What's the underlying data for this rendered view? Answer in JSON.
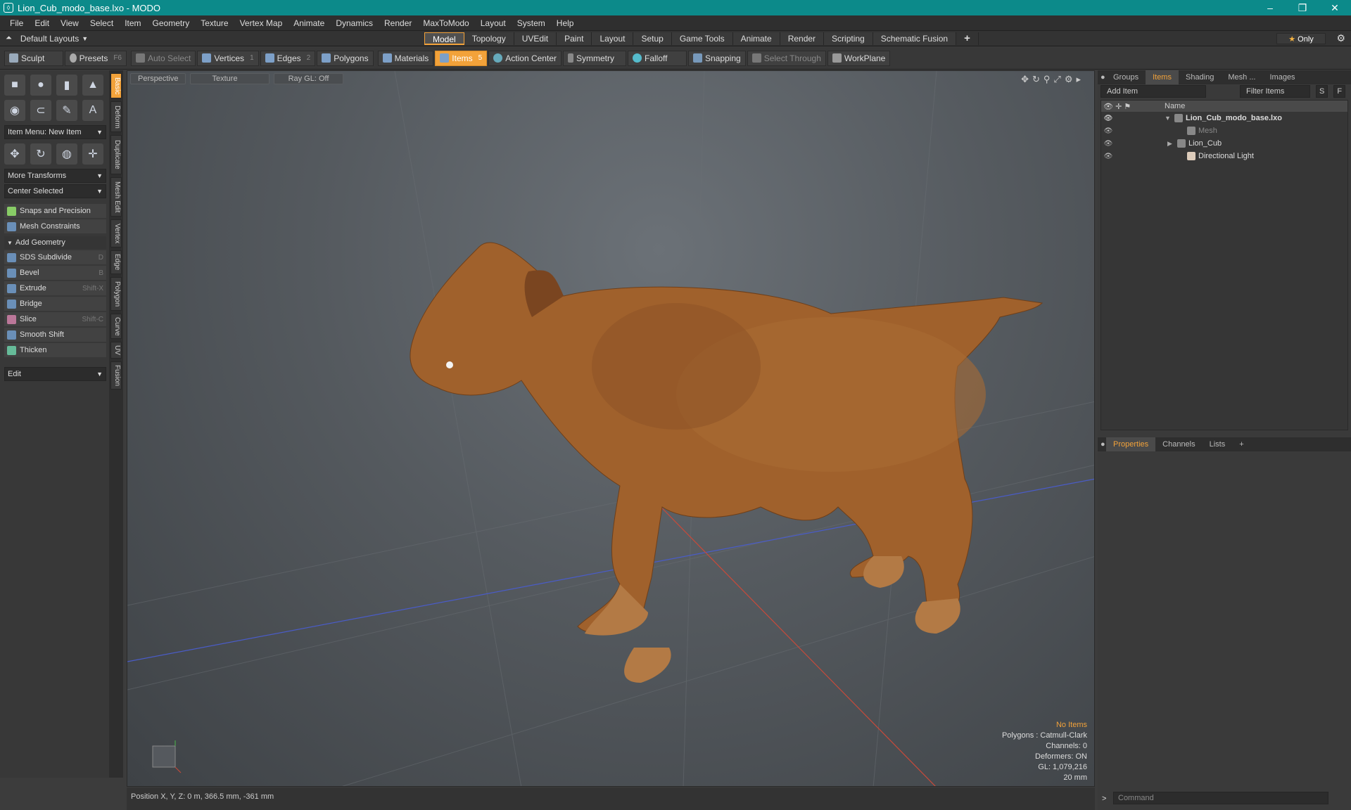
{
  "window": {
    "title": "Lion_Cub_modo_base.lxo - MODO",
    "min": "–",
    "max": "❐",
    "close": "✕"
  },
  "menu": [
    "File",
    "Edit",
    "View",
    "Select",
    "Item",
    "Geometry",
    "Texture",
    "Vertex Map",
    "Animate",
    "Dynamics",
    "Render",
    "MaxToModo",
    "Layout",
    "System",
    "Help"
  ],
  "layoutbar": {
    "layouts": "Default Layouts",
    "tabs": [
      "Model",
      "Topology",
      "UVEdit",
      "Paint",
      "Layout",
      "Setup",
      "Game Tools",
      "Animate",
      "Render",
      "Scripting",
      "Schematic Fusion"
    ],
    "active": "Model",
    "plus": "+",
    "only": "Only",
    "only_icon": "★"
  },
  "toolbar": {
    "sculpt": "Sculpt",
    "presets": "Presets",
    "presets_key": "F6",
    "auto_select": "Auto Select",
    "vertices": "Vertices",
    "vertices_n": "1",
    "edges": "Edges",
    "edges_n": "2",
    "polygons": "Polygons",
    "materials": "Materials",
    "items": "Items",
    "items_n": "5",
    "action_center": "Action Center",
    "symmetry": "Symmetry",
    "falloff": "Falloff",
    "snapping": "Snapping",
    "select_through": "Select Through",
    "workplane": "WorkPlane"
  },
  "left": {
    "item_menu": "Item Menu: New Item",
    "more_transforms": "More Transforms",
    "center_selected": "Center Selected",
    "snaps": "Snaps and Precision",
    "mesh_constraints": "Mesh Constraints",
    "add_geometry": "Add Geometry",
    "tools": [
      {
        "label": "SDS Subdivide",
        "key": "D"
      },
      {
        "label": "Bevel",
        "key": "B"
      },
      {
        "label": "Extrude",
        "key": "Shift-X"
      },
      {
        "label": "Bridge",
        "key": ""
      },
      {
        "label": "Slice",
        "key": "Shift-C"
      },
      {
        "label": "Smooth Shift",
        "key": ""
      },
      {
        "label": "Thicken",
        "key": ""
      }
    ],
    "edit": "Edit",
    "vtabs": [
      "Basic",
      "Deform",
      "Duplicate",
      "Mesh Edit",
      "Vertex",
      "Edge",
      "Polygon",
      "Curve",
      "UV",
      "Fusion"
    ]
  },
  "viewport": {
    "tabs": [
      "Perspective",
      "Texture",
      "Ray GL: Off"
    ],
    "info": {
      "items": "No Items",
      "polygons": "Polygons : Catmull-Clark",
      "channels": "Channels: 0",
      "deformers": "Deformers: ON",
      "gl": "GL: 1,079,216",
      "scale": "20 mm"
    }
  },
  "status": {
    "position": "Position X, Y, Z:  0 m, 366.5 mm, -361 mm"
  },
  "right": {
    "tabs": [
      "Groups",
      "Items",
      "Shading",
      "Mesh ...",
      "Images"
    ],
    "active": "Items",
    "add_item": "Add Item",
    "filter": "Filter Items",
    "s": "S",
    "f": "F",
    "name_col": "Name",
    "tree": [
      {
        "label": "Lion_Cub_modo_base.lxo",
        "kind": "scene"
      },
      {
        "label": "Mesh",
        "kind": "mesh"
      },
      {
        "label": "Lion_Cub",
        "kind": "mesh"
      },
      {
        "label": "Directional Light",
        "kind": "light"
      }
    ],
    "props_tabs": [
      "Properties",
      "Channels",
      "Lists"
    ],
    "props_active": "Properties",
    "plus": "+",
    "command": "Command"
  },
  "colors": {
    "accent": "#f2a23a",
    "titlebar": "#0c8a8a"
  }
}
